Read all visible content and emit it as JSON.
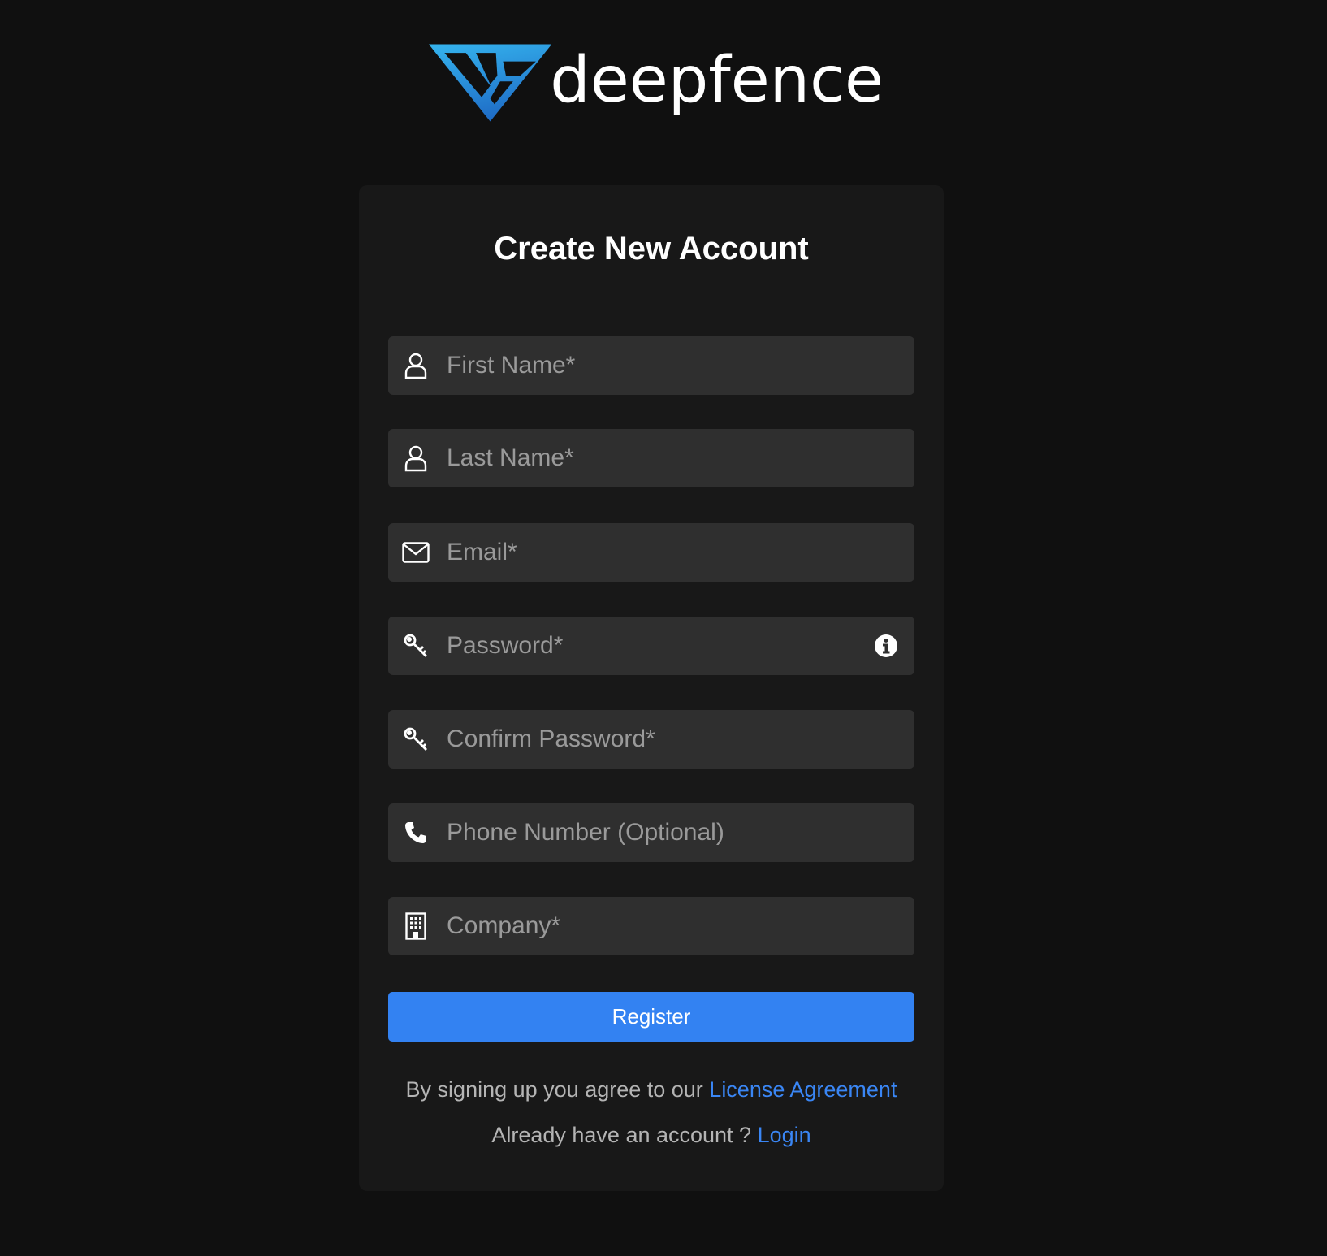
{
  "brand": {
    "name": "deepfence"
  },
  "form": {
    "title": "Create New Account",
    "fields": {
      "first_name": "First Name*",
      "last_name": "Last Name*",
      "email": "Email*",
      "password": "Password*",
      "confirm_password": "Confirm Password*",
      "phone": "Phone Number (Optional)",
      "company": "Company*"
    },
    "register_label": "Register"
  },
  "footer": {
    "agree_text": "By signing up you agree to our ",
    "license_link": "License Agreement",
    "account_text": "Already have an account ? ",
    "login_link": "Login"
  },
  "colors": {
    "background": "#101010",
    "card": "#181818",
    "input": "#2f2f2f",
    "accent": "#3382f2",
    "link": "#3a86f4"
  },
  "icons": {
    "first_name": "user-icon",
    "last_name": "user-icon",
    "email": "envelope-icon",
    "password": "key-icon",
    "password_help": "info-icon",
    "confirm_password": "key-icon",
    "phone": "phone-icon",
    "company": "building-icon"
  }
}
